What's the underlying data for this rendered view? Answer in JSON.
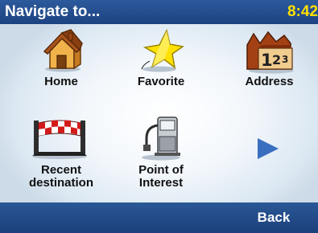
{
  "header": {
    "title": "Navigate to...",
    "clock": "8:42"
  },
  "menu": {
    "items": [
      {
        "label": "Home",
        "icon": "house-icon"
      },
      {
        "label": "Favorite",
        "icon": "star-icon"
      },
      {
        "label": "Address",
        "icon": "numbered-buildings-icon"
      },
      {
        "label_line1": "Recent",
        "label_line2": "destination",
        "icon": "finish-flag-icon"
      },
      {
        "label_line1": "Point of",
        "label_line2": "Interest",
        "icon": "gas-pump-icon"
      }
    ],
    "next_icon": "next-page-arrow-icon"
  },
  "address_icon_digits": [
    "1",
    "2",
    "3"
  ],
  "footer": {
    "back_label": "Back"
  },
  "colors": {
    "titlebar": "#1d4281",
    "clock": "#ffe000",
    "arrow": "#3a6fc0"
  }
}
